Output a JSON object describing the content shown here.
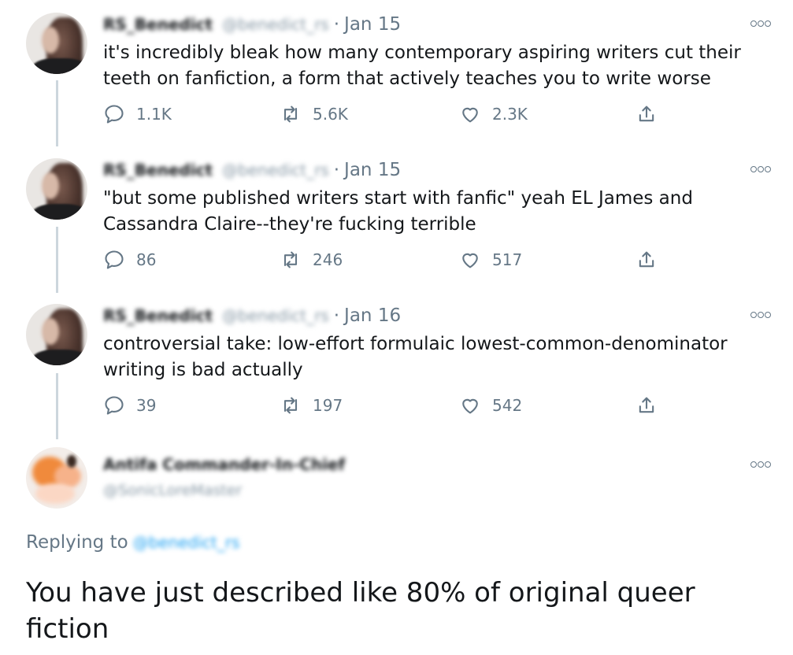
{
  "tweets": [
    {
      "author_name": "RS_Benedict",
      "author_handle": "@benedict_rs",
      "separator": "·",
      "date": "Jan 15",
      "text": "it's incredibly bleak how many contemporary aspiring writers cut their teeth on fanfiction, a form that actively teaches you to write worse",
      "replies": "1.1K",
      "retweets": "5.6K",
      "likes": "2.3K"
    },
    {
      "author_name": "RS_Benedict",
      "author_handle": "@benedict_rs",
      "separator": "·",
      "date": "Jan 15",
      "text": "\"but some published writers start with fanfic\" yeah EL James and Cassandra Claire--they're fucking terrible",
      "replies": "86",
      "retweets": "246",
      "likes": "517"
    },
    {
      "author_name": "RS_Benedict",
      "author_handle": "@benedict_rs",
      "separator": "·",
      "date": "Jan 16",
      "text": "controversial take: low-effort formulaic lowest-common-denominator writing is bad actually",
      "replies": "39",
      "retweets": "197",
      "likes": "542"
    }
  ],
  "reply": {
    "author_name": "Antifa Commander-In-Chief",
    "author_handle": "@SonicLoreMaster",
    "replying_label": "Replying to",
    "replying_mention": "@benedict_rs",
    "text": "You have just described like 80% of original queer fiction"
  },
  "icons": {
    "reply": "speech-bubble-icon",
    "retweet": "retweet-icon",
    "like": "heart-icon",
    "share": "share-upload-icon",
    "more": "more-dots-icon"
  },
  "colors": {
    "text": "#14171a",
    "secondary": "#657786",
    "thread_line": "#ccd6dd",
    "link": "#1da1f2"
  }
}
